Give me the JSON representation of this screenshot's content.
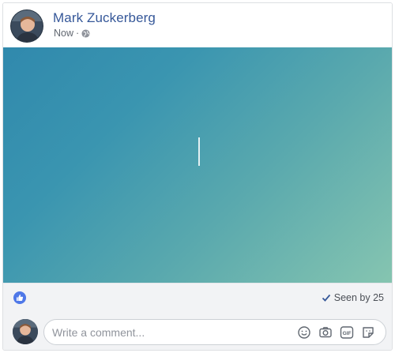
{
  "post": {
    "author_name": "Mark Zuckerberg",
    "timestamp": "Now",
    "separator": "·",
    "privacy_icon": "globe-icon"
  },
  "canvas": {
    "gradient_start": "#3089ad",
    "gradient_end": "#86c5b0"
  },
  "reactions": {
    "icon": "like-icon",
    "seen_label": "Seen by 25"
  },
  "comment": {
    "placeholder": "Write a comment...",
    "tools": [
      "emoji-icon",
      "camera-icon",
      "gif-icon",
      "sticker-icon"
    ]
  },
  "colors": {
    "link_blue": "#365899",
    "like_blue": "#4f78e8",
    "bar_background": "#f2f3f5"
  }
}
